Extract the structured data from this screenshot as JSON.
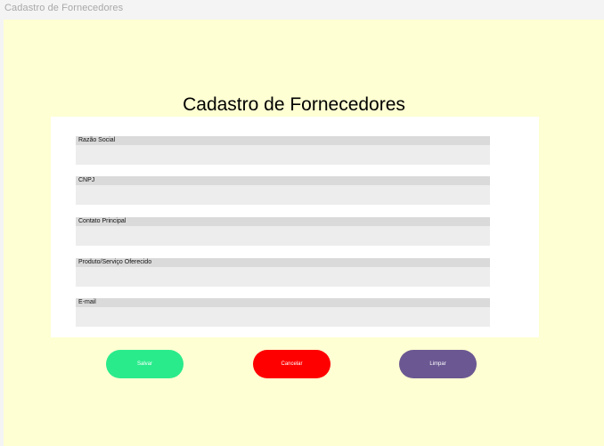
{
  "window": {
    "title": "Cadastro de Fornecedores"
  },
  "form": {
    "heading": "Cadastro de Fornecedores",
    "fields": [
      {
        "label": "Razão Social",
        "value": ""
      },
      {
        "label": "CNPJ",
        "value": ""
      },
      {
        "label": "Contato Principal",
        "value": ""
      },
      {
        "label": "Produto/Serviço Oferecido",
        "value": ""
      },
      {
        "label": "E-mail",
        "value": ""
      }
    ]
  },
  "buttons": {
    "save": {
      "label": "Salvar",
      "color": "#2aeb8c"
    },
    "cancel": {
      "label": "Cancelar",
      "color": "#ff0000"
    },
    "clear": {
      "label": "Limpar",
      "color": "#6b5892"
    }
  },
  "colors": {
    "background": "#feffd2",
    "card": "#ffffff",
    "label_bar": "#dadada",
    "input": "#ededed"
  }
}
